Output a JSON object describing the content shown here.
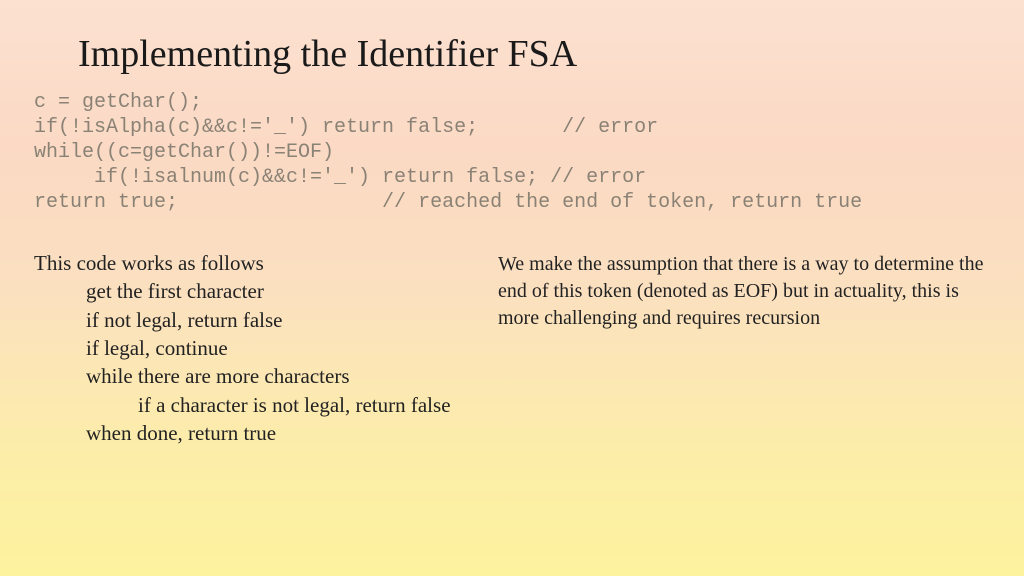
{
  "title": "Implementing the Identifier FSA",
  "code": {
    "l1": "c = getChar();",
    "l2": "if(!isAlpha(c)&&c!='_') return false;       // error",
    "l3": "while((c=getChar())!=EOF)",
    "l4": "     if(!isalnum(c)&&c!='_') return false; // error",
    "l5": "return true;                 // reached the end of token, return true"
  },
  "left": {
    "heading": "This code works as follows",
    "step1": "get the first character",
    "step2": "if not legal, return false",
    "step3": "if legal, continue",
    "step4": "while there are more characters",
    "step5": "if a character is not legal, return false",
    "step6": "when done, return true"
  },
  "right": {
    "text": "We make the assumption that there is a way to determine the end of this token (denoted as EOF) but in actuality, this is more challenging and requires recursion"
  }
}
